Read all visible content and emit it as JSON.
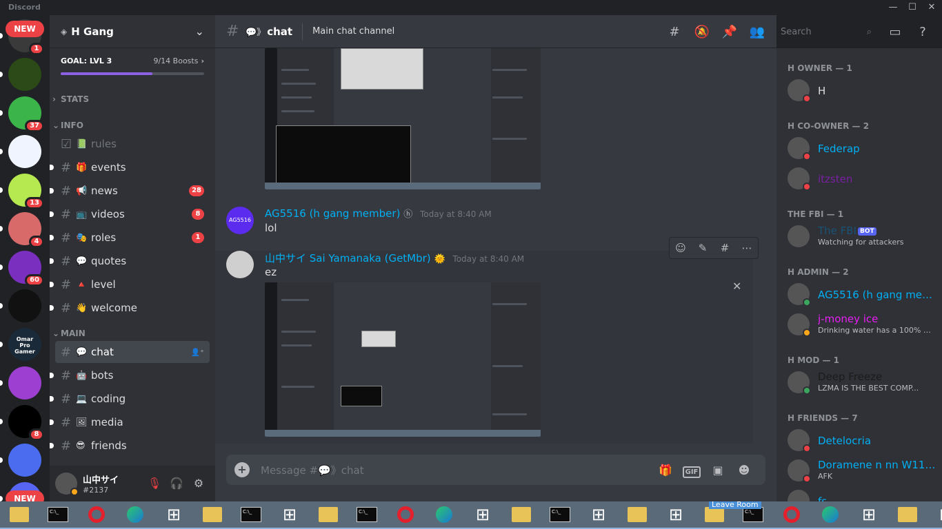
{
  "window": {
    "app_name": "Discord",
    "minimize": "—",
    "maximize": "☐",
    "close": "✕"
  },
  "servers": [
    {
      "badge": "1",
      "color": "#3a3a3a",
      "new_label": "NEW"
    },
    {
      "badge": "",
      "color": "#2b4a18"
    },
    {
      "badge": "37",
      "color": "#3bb54a"
    },
    {
      "badge": "",
      "color": "#f0f4ff"
    },
    {
      "badge": "13",
      "color": "#b6e84f"
    },
    {
      "badge": "4",
      "color": "#d86a6a"
    },
    {
      "badge": "60",
      "color": "#7a2fbf"
    },
    {
      "badge": "",
      "color": "#111"
    },
    {
      "badge": "",
      "color": "#1b2a38",
      "label": "Omar Pro Gamer"
    },
    {
      "badge": "",
      "color": "#9d3fd0"
    },
    {
      "badge": "8",
      "color": "#000"
    },
    {
      "badge": "",
      "color": "#4c6cf0"
    },
    {
      "badge": "",
      "color": "#5865f2",
      "new_label": "NEW"
    }
  ],
  "guild": {
    "name": "H Gang",
    "goal_label": "GOAL: LVL 3",
    "boosts": "9/14 Boosts",
    "boost_progress": 0.64
  },
  "categories": {
    "stats": "STATS",
    "info": "INFO",
    "main": "MAIN"
  },
  "channels": [
    {
      "name": "rules",
      "emoji": "📗",
      "badge": "",
      "muted": true
    },
    {
      "name": "events",
      "emoji": "🎁",
      "badge": ""
    },
    {
      "name": "news",
      "emoji": "📢",
      "badge": "28"
    },
    {
      "name": "videos",
      "emoji": "📺",
      "badge": "8"
    },
    {
      "name": "roles",
      "emoji": "🎭",
      "badge": "1"
    },
    {
      "name": "quotes",
      "emoji": "💬",
      "badge": ""
    },
    {
      "name": "level",
      "emoji": "🔺",
      "badge": ""
    },
    {
      "name": "welcome",
      "emoji": "👋",
      "badge": ""
    },
    {
      "name": "chat",
      "emoji": "💬",
      "badge": "",
      "active": true
    },
    {
      "name": "bots",
      "emoji": "🤖",
      "badge": ""
    },
    {
      "name": "coding",
      "emoji": "💻",
      "badge": ""
    },
    {
      "name": "media",
      "emoji": "🖼",
      "badge": ""
    },
    {
      "name": "friends",
      "emoji": "😎",
      "badge": ""
    }
  ],
  "user": {
    "name": "山中サイ",
    "tag": "#2137"
  },
  "channel_header": {
    "name": "chat",
    "topic": "Main chat channel"
  },
  "search": {
    "placeholder": "Search"
  },
  "messages": [
    {
      "author": "AG5516 (h gang member)",
      "time": "Today at 8:40 AM",
      "text": "lol",
      "avatar_text": "AG5516"
    },
    {
      "author": "山中サイ Sai Yamanaka (GetMbr)",
      "time": "Today at 8:40 AM",
      "text": "ez"
    }
  ],
  "composer": {
    "placeholder": "Message #💬》chat",
    "gif": "GIF"
  },
  "member_groups": [
    {
      "title": "H OWNER — 1",
      "members": [
        {
          "name": "H",
          "status_text": "",
          "color": "#dcddde",
          "status": "#ed4245"
        }
      ]
    },
    {
      "title": "H CO-OWNER — 2",
      "members": [
        {
          "name": "Federap",
          "status_text": "",
          "color": "#00b0f4",
          "status": "#ed4245"
        },
        {
          "name": "itzsten",
          "status_text": "",
          "color": "#7a1fa2",
          "status": "#ed4245"
        }
      ]
    },
    {
      "title": "THE FBI — 1",
      "members": [
        {
          "name": "The FBI",
          "bot": "BOT",
          "status_text": "Watching for attackers",
          "color": "#1a5276",
          "status": ""
        }
      ]
    },
    {
      "title": "H ADMIN — 2",
      "members": [
        {
          "name": "AG5516 (h gang mem...",
          "status_text": "",
          "color": "#00b0f4",
          "status": "#3ba55d"
        },
        {
          "name": "j-money ice",
          "status_text": "Drinking water has a 100% mo...",
          "color": "#e91ef5",
          "status": "#faa61a"
        }
      ]
    },
    {
      "title": "H MOD — 1",
      "members": [
        {
          "name": "Deep Freeze",
          "status_text": "LZMA IS THE BEST COMP...",
          "color": "#1b1b1b",
          "status": "#3ba55d"
        }
      ]
    },
    {
      "title": "H FRIENDS — 7",
      "members": [
        {
          "name": "Detelocria",
          "status_text": "",
          "color": "#00b0f4",
          "status": "#ed4245"
        },
        {
          "name": "Doramene n nn W11 U...",
          "status_text": "AFK",
          "color": "#00b0f4",
          "status": "#ed4245"
        },
        {
          "name": "fs",
          "status_text": "",
          "color": "#00b0f4",
          "status": ""
        }
      ]
    }
  ],
  "taskbar": {
    "leave_room": "Leave Room"
  }
}
